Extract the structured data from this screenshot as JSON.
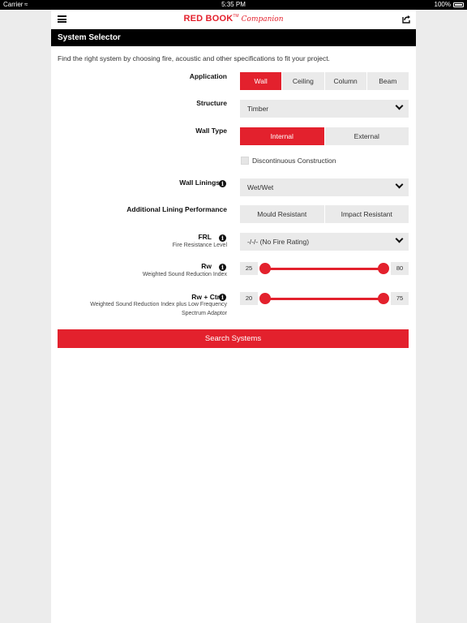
{
  "status_bar": {
    "carrier": "Carrier",
    "time": "5:35 PM",
    "battery": "100%"
  },
  "navbar": {
    "logo_main": "RED BOOK",
    "logo_tm": "TM",
    "logo_script": "Companion"
  },
  "header": {
    "title": "System Selector"
  },
  "intro": "Find the right system by choosing fire, acoustic and other specifications to fit your project.",
  "application": {
    "label": "Application",
    "options": [
      "Wall",
      "Ceiling",
      "Column",
      "Beam"
    ],
    "selected": "Wall"
  },
  "structure": {
    "label": "Structure",
    "value": "Timber"
  },
  "wall_type": {
    "label": "Wall Type",
    "options": [
      "Internal",
      "External"
    ],
    "selected": "Internal"
  },
  "discontinuous": {
    "label": "Discontinuous Construction",
    "checked": false
  },
  "wall_linings": {
    "label": "Wall Linings",
    "value": "Wet/Wet"
  },
  "additional_lining": {
    "label": "Additional Lining Performance",
    "options": [
      "Mould Resistant",
      "Impact Resistant"
    ]
  },
  "frl": {
    "label": "FRL",
    "sublabel": "Fire Resistance Level",
    "value": "-/-/- (No Fire Rating)"
  },
  "rw": {
    "label": "Rw",
    "sublabel": "Weighted Sound Reduction Index",
    "min": "25",
    "max": "80"
  },
  "rw_ctr": {
    "label": "Rw + Ctr",
    "sublabel_1": "Weighted Sound Reduction Index plus Low Frequency",
    "sublabel_2": "Spectrum Adaptor",
    "min": "20",
    "max": "75"
  },
  "search_button": "Search Systems",
  "colors": {
    "accent": "#e3212d",
    "header_bg": "#000000",
    "control_bg": "#eaeaea"
  }
}
